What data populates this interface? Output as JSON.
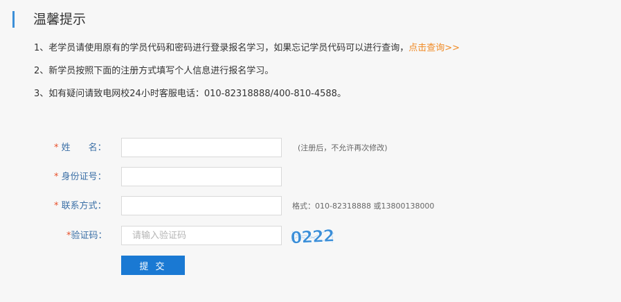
{
  "header": {
    "title": "温馨提示"
  },
  "notice": {
    "line1_text": "1、老学员请使用原有的学员代码和密码进行登录报名学习，如果忘记学员代码可以进行查询，",
    "line1_link": "点击查询>>",
    "line2_text": "2、新学员按照下面的注册方式填写个人信息进行报名学习。",
    "line3_text": "3、如有疑问请致电网校24小时客服电话：010-82318888/400-810-4588。"
  },
  "form": {
    "name": {
      "required_mark": "*",
      "label": "姓　　名：",
      "value": "",
      "hint": "(注册后，不允许再次修改)"
    },
    "id_number": {
      "required_mark": "*",
      "label": "身份证号：",
      "value": ""
    },
    "contact": {
      "required_mark": "*",
      "label": "联系方式：",
      "value": "",
      "hint": "格式：010-82318888 或13800138000"
    },
    "captcha": {
      "required_mark": "*",
      "label": "验证码：",
      "value": "",
      "placeholder": "请输入验证码",
      "image_text": "0222"
    },
    "submit_label": "提 交"
  },
  "colors": {
    "accent": "#3c8fd8",
    "link": "#f08a24",
    "label": "#3a6fa6",
    "required": "#e8512c",
    "button": "#1a79d3",
    "captcha": "#3c8fd8"
  }
}
